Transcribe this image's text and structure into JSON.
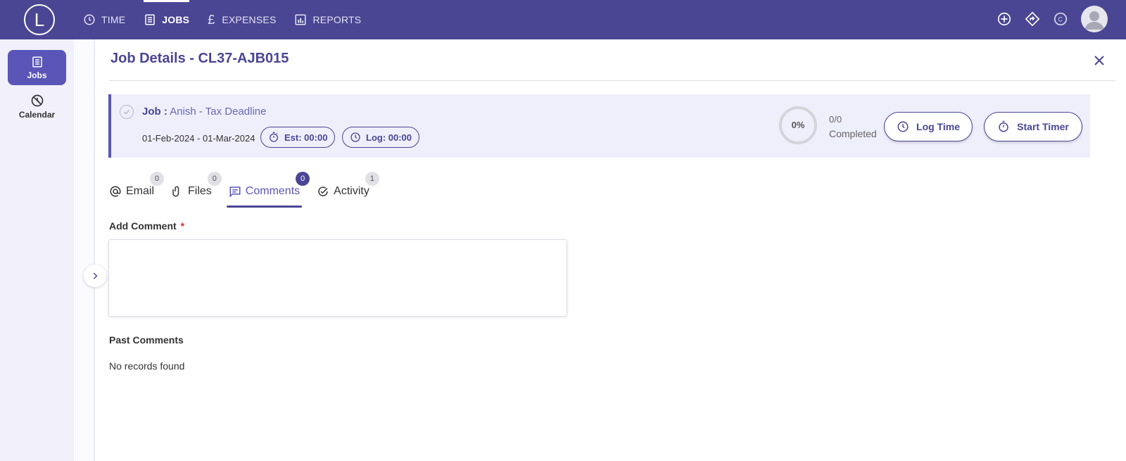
{
  "app": {
    "logo_letter": "L"
  },
  "nav": {
    "items": [
      {
        "label": "TIME",
        "icon": "clock-icon"
      },
      {
        "label": "JOBS",
        "icon": "list-icon",
        "active": true
      },
      {
        "label": "EXPENSES",
        "icon": "pound-icon"
      },
      {
        "label": "REPORTS",
        "icon": "bar-chart-icon"
      }
    ]
  },
  "sidebar": {
    "items": [
      {
        "label": "Jobs",
        "icon": "list-icon",
        "active": true
      },
      {
        "label": "Calendar",
        "icon": "calendar-off-icon"
      }
    ]
  },
  "page": {
    "title": "Job Details - CL37-AJB015"
  },
  "job": {
    "label": "Job :",
    "name": "Anish - Tax Deadline",
    "dates": "01-Feb-2024 - 01-Mar-2024",
    "est": "Est: 00:00",
    "log": "Log: 00:00",
    "progress_text": "0%",
    "progress_value": 0,
    "completed_count": "0/0",
    "completed_label": "Completed",
    "log_time_label": "Log Time",
    "start_timer_label": "Start Timer"
  },
  "tabs": [
    {
      "label": "Email",
      "badge": "0",
      "icon": "at-icon"
    },
    {
      "label": "Files",
      "badge": "0",
      "icon": "paperclip-icon"
    },
    {
      "label": "Comments",
      "badge": "0",
      "icon": "comment-icon",
      "active": true
    },
    {
      "label": "Activity",
      "badge": "1",
      "icon": "check-circle-icon"
    }
  ],
  "comments": {
    "add_label": "Add Comment",
    "required_mark": "*",
    "input_value": "",
    "past_label": "Past Comments",
    "empty_text": "No records found"
  },
  "colors": {
    "brand": "#4a4694",
    "accent": "#5a55b7",
    "required": "#d9302c"
  }
}
